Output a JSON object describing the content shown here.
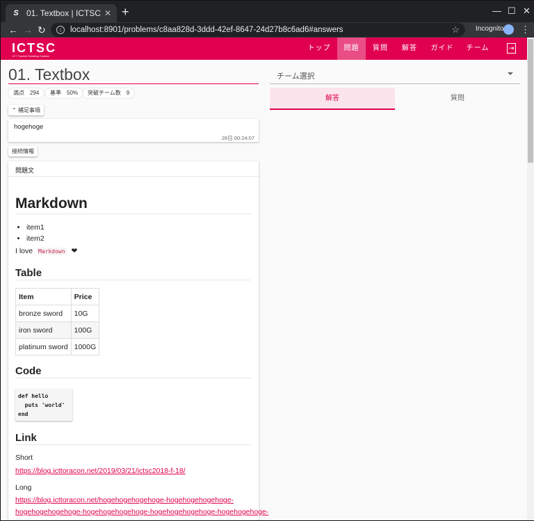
{
  "browser": {
    "tab_title": "01. Textbox | ICTSC",
    "favicon_glyph": "S",
    "url": "localhost:8901/problems/c8aa828d-3ddd-42ef-8647-24d27b8c6ad6#answers",
    "incognito_label": "Incognito"
  },
  "app": {
    "logo": "ICTSC",
    "logo_sub": "ICT Trouble Shooting Contest",
    "nav": [
      "トップ",
      "問題",
      "質問",
      "解答",
      "ガイド",
      "チーム"
    ],
    "nav_active": "問題",
    "accent": "#e0004f"
  },
  "problem": {
    "title": "01. Textbox",
    "chips": [
      "満点　294",
      "基準　50%",
      "突破チーム数　9"
    ],
    "supplement_button": "補足事項",
    "supplement_text": "hogehoge",
    "supplement_time": "26日 00:24:07",
    "connection_button": "接続情報",
    "statement_label": "問題文"
  },
  "markdown": {
    "h1": "Markdown",
    "list": [
      "item1",
      "item2"
    ],
    "love_prefix": "I love",
    "love_code": "Markdown",
    "heart": "❤",
    "h_table": "Table",
    "table_headers": [
      "Item",
      "Price"
    ],
    "table_rows": [
      [
        "bronze sword",
        "10G"
      ],
      [
        "iron sword",
        "100G"
      ],
      [
        "platinum sword",
        "1000G"
      ]
    ],
    "h_code": "Code",
    "code": "def hello\n  puts 'world'\nend",
    "h_link": "Link",
    "short_label": "Short",
    "short_url": "https://blog.icttoracon.net/2019/03/21/ictsc2018-f-18/",
    "long_label": "Long",
    "long_url_1": "https://blog.icttoracon.net/hogehogehogehoge-hogehogehogehoge-",
    "long_url_2": "hogehogehogehoge-hogehogehogehoge-hogehogehogehoge-hogehogehoge-"
  },
  "right": {
    "team_select_placeholder": "チーム選択",
    "tabs": [
      "解答",
      "質問"
    ]
  }
}
